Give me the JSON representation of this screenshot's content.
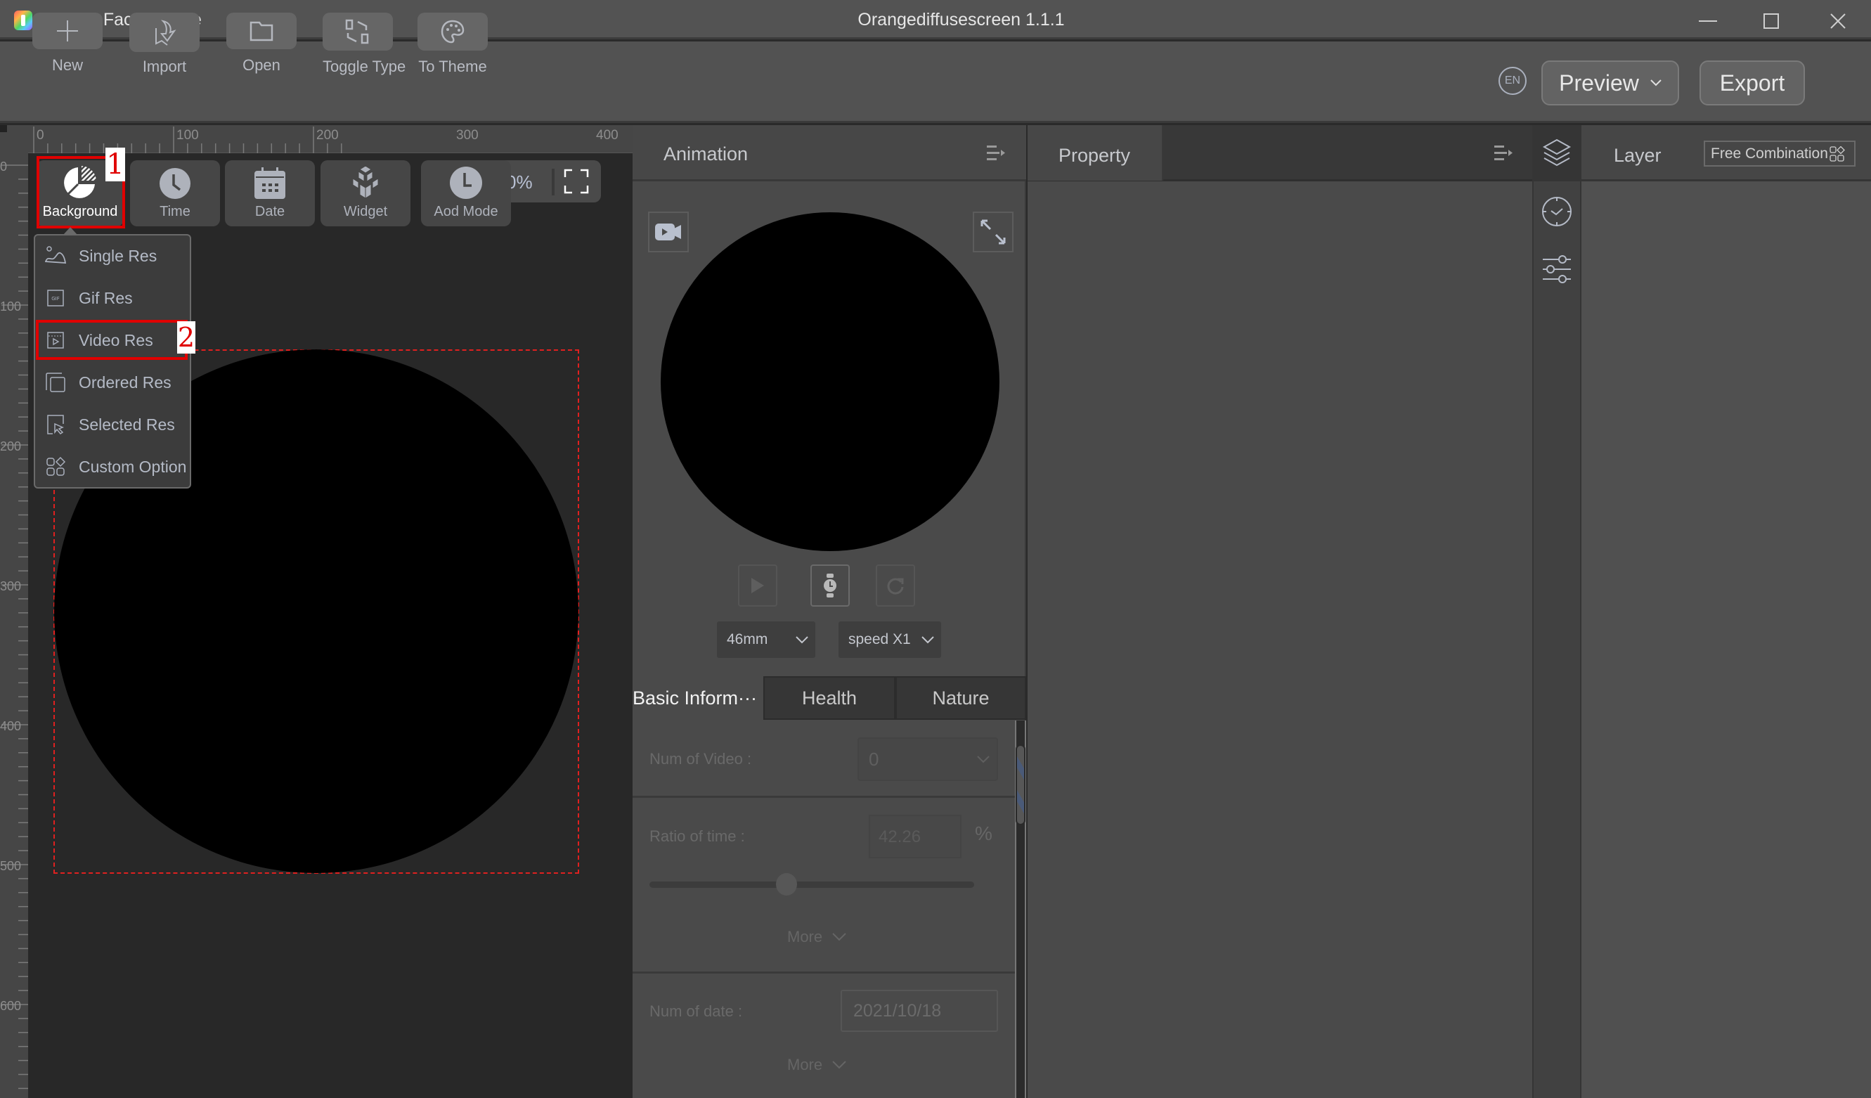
{
  "window": {
    "app_name": "Watch Face Theme",
    "title": "Orangediffusescreen 1.1.1",
    "controls": [
      "minimize",
      "maximize",
      "close"
    ]
  },
  "toolbar": {
    "items": [
      {
        "label": "New",
        "icon": "plus-icon"
      },
      {
        "label": "Import",
        "icon": "import-icon"
      },
      {
        "label": "Open",
        "icon": "folder-icon"
      },
      {
        "label": "Toggle Type",
        "icon": "toggle-type-icon"
      },
      {
        "label": "To Theme",
        "icon": "palette-icon"
      }
    ],
    "language": "EN",
    "preview_label": "Preview",
    "export_label": "Export"
  },
  "canvas": {
    "ruler_top": [
      "0",
      "100",
      "200",
      "300",
      "400"
    ],
    "ruler_left": [
      "0",
      "100",
      "200",
      "300",
      "400",
      "500",
      "600"
    ],
    "components": [
      {
        "label": "Background",
        "icon": "pie-chart-icon",
        "selected": true
      },
      {
        "label": "Time",
        "icon": "clock-icon"
      },
      {
        "label": "Date",
        "icon": "calendar-icon"
      },
      {
        "label": "Widget",
        "icon": "widget-cubes-icon"
      },
      {
        "label": "Aod Mode",
        "icon": "aod-clock-icon"
      }
    ],
    "zoom_text": "0%",
    "annotations": {
      "step1": "1",
      "step2": "2",
      "color": "#e00000"
    },
    "background_menu": [
      {
        "label": "Single Res",
        "icon": "image-icon"
      },
      {
        "label": "Gif Res",
        "icon": "gif-icon"
      },
      {
        "label": "Video Res",
        "icon": "video-icon",
        "highlighted": true
      },
      {
        "label": "Ordered Res",
        "icon": "ordered-icon"
      },
      {
        "label": "Selected Res",
        "icon": "selected-icon"
      },
      {
        "label": "Custom Option",
        "icon": "custom-option-icon"
      }
    ]
  },
  "animation": {
    "title": "Animation",
    "size_select": "46mm",
    "speed_select": "speed X1",
    "tabs": [
      "Basic Inform···",
      "Health",
      "Nature"
    ],
    "active_tab": 0,
    "form": {
      "num_video_label": "Num of Video :",
      "num_video_value": "0",
      "ratio_label": "Ratio of time :",
      "ratio_value": "42.26",
      "ratio_unit": "%",
      "ratio_slider_percent": 42.26,
      "more_label": "More",
      "num_date_label": "Num of date :",
      "num_date_value": "2021/10/18",
      "more_label_2": "More"
    }
  },
  "property": {
    "title": "Property"
  },
  "layer": {
    "title": "Layer",
    "free_combination": "Free Combination"
  }
}
